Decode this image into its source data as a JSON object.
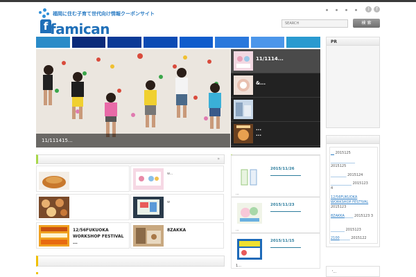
{
  "header": {
    "tagline": "福岡に住む子育て世代向け情報クーポンサイト",
    "logo_text": "famican",
    "search_placeholder": "SEARCH",
    "search_button": "検 索",
    "social": [
      "rss-icon",
      "facebook-icon"
    ]
  },
  "nav": {
    "colors": [
      "#2a8bc8",
      "#0a2a7a",
      "#0b3a96",
      "#0c4bb4",
      "#0f5ccc",
      "#2a78dc",
      "#4c96ea",
      "#2a9ad0"
    ]
  },
  "slider": {
    "caption": "11/111415...",
    "thumbs": [
      {
        "title": "11/1114..."
      },
      {
        "title": "&..."
      },
      {
        "title": ""
      },
      {
        "title": "...\n..."
      }
    ]
  },
  "features": {
    "arrow": "»",
    "items": [
      {
        "title": "",
        "sub": ""
      },
      {
        "title": "",
        "sub": "w..."
      },
      {
        "title": "",
        "sub": ""
      },
      {
        "title": "",
        "sub": "w"
      },
      {
        "title": "12/56FUKUOKA WORKSHOP FESTIVAL ...",
        "sub": ""
      },
      {
        "title": "8ZAKKA",
        "sub": ""
      }
    ]
  },
  "news": {
    "items": [
      {
        "date": "2015/11/26",
        "foot": "..."
      },
      {
        "date": "2015/11/23",
        "foot": "..."
      },
      {
        "date": "2015/11/15",
        "foot": "1..."
      }
    ]
  },
  "sidebar": {
    "pr_title": "PR",
    "list": [
      {
        "link": "__",
        "num": "2015125",
        "extra": ""
      },
      {
        "link": "",
        "num": "2015125",
        "extra": ""
      },
      {
        "link": "",
        "num": "2015124",
        "extra": ""
      },
      {
        "link": "",
        "num": "2015123",
        "extra": "4"
      },
      {
        "link": "12/56FUKUOKA WORKSHOP FESTIVAL",
        "num": "2015123",
        "extra": ""
      },
      {
        "link": "8ZAKKA",
        "num": "2015123",
        "extra": "3"
      },
      {
        "link": "",
        "num": "2015123",
        "extra": ""
      },
      {
        "link": "2100",
        "num": "2015122",
        "extra": ""
      }
    ],
    "bottom": "'..."
  }
}
